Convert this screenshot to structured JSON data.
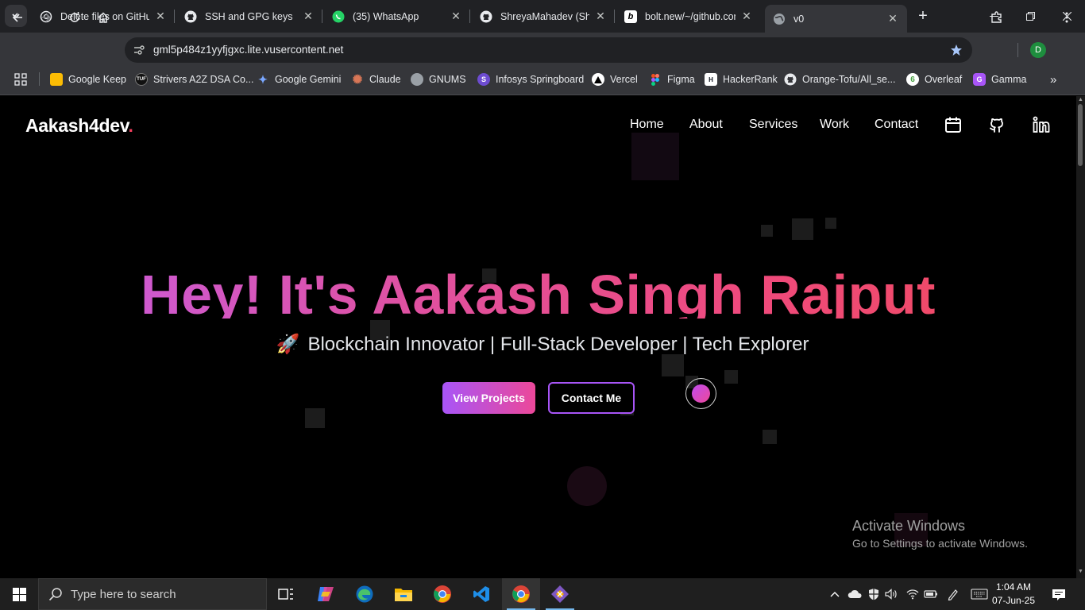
{
  "browser": {
    "tabs": [
      {
        "title": "Delete files on GitHub",
        "icon": "chatgpt-icon"
      },
      {
        "title": "SSH and GPG keys",
        "icon": "github-icon"
      },
      {
        "title": "(35) WhatsApp",
        "icon": "whatsapp-icon"
      },
      {
        "title": "ShreyaMahadev (Shreya)",
        "icon": "github-icon"
      },
      {
        "title": "bolt.new/~/github.com",
        "icon": "bolt-icon"
      },
      {
        "title": "v0",
        "icon": "globe-icon",
        "active": true
      }
    ],
    "url": "gml5p484z1yyfjgxc.lite.vusercontent.net",
    "profile_initial": "D",
    "bookmarks": [
      {
        "label": "Google Keep",
        "color": "#fbbc04"
      },
      {
        "label": "Strivers A2Z DSA Co...",
        "color": "#333333"
      },
      {
        "label": "Google Gemini",
        "color": "#4f8ef7"
      },
      {
        "label": "Claude",
        "color": "#d97757"
      },
      {
        "label": "GNUMS",
        "color": "#9aa0a6"
      },
      {
        "label": "Infosys Springboard",
        "color": "#7b61ff"
      },
      {
        "label": "Vercel",
        "color": "#ffffff"
      },
      {
        "label": "Figma",
        "color": "#f24e1e"
      },
      {
        "label": "HackerRank",
        "color": "#1ba94c"
      },
      {
        "label": "Orange-Tofu/All_se...",
        "color": "#ffffff"
      },
      {
        "label": "Overleaf",
        "color": "#47a141"
      },
      {
        "label": "Gamma",
        "color": "#a855f7"
      }
    ]
  },
  "site": {
    "logo": "Aakash4dev",
    "logo_dot": ".",
    "nav": [
      "Home",
      "About",
      "Services",
      "Work",
      "Contact"
    ],
    "hero_title": "Hey! It's Aakash Singh Rajput",
    "hero_subtitle": "Blockchain Innovator | Full-Stack Developer | Tech Explorer",
    "rocket": "🚀",
    "primary_button": "View Projects",
    "secondary_button": "Contact Me",
    "accent_colors": {
      "purple": "#a855f7",
      "pink": "#ec4899",
      "rose": "#f43f5e"
    }
  },
  "watermark": {
    "line1": "Activate Windows",
    "line2": "Go to Settings to activate Windows."
  },
  "taskbar": {
    "search_placeholder": "Type here to search",
    "time": "1:04 AM",
    "date": "07-Jun-25"
  }
}
